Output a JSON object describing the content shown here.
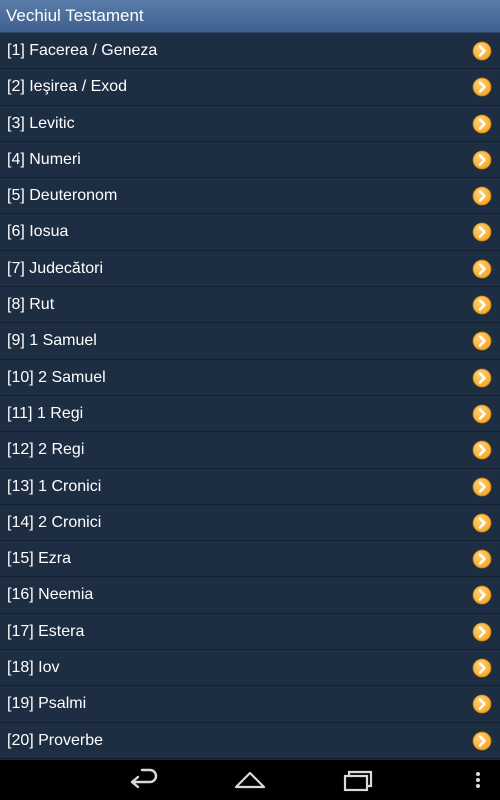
{
  "header": {
    "title": "Vechiul Testament"
  },
  "books": [
    {
      "label": "[1] Facerea / Geneza"
    },
    {
      "label": "[2] Ieşirea / Exod"
    },
    {
      "label": "[3] Levitic"
    },
    {
      "label": "[4] Numeri"
    },
    {
      "label": "[5] Deuteronom"
    },
    {
      "label": "[6] Iosua"
    },
    {
      "label": "[7] Judecători"
    },
    {
      "label": "[8] Rut"
    },
    {
      "label": "[9] 1 Samuel"
    },
    {
      "label": "[10] 2 Samuel"
    },
    {
      "label": "[11] 1 Regi"
    },
    {
      "label": "[12] 2 Regi"
    },
    {
      "label": "[13] 1 Cronici"
    },
    {
      "label": "[14] 2 Cronici"
    },
    {
      "label": "[15] Ezra"
    },
    {
      "label": "[16] Neemia"
    },
    {
      "label": "[17] Estera"
    },
    {
      "label": "[18] Iov"
    },
    {
      "label": "[19] Psalmi"
    },
    {
      "label": "[20] Proverbe"
    }
  ],
  "colors": {
    "header_bg": "#4a6d9a",
    "list_bg": "#1d2d42",
    "arrow_orange": "#f5a623",
    "text": "#ffffff"
  },
  "icons": {
    "row_action": "chevron-right-icon",
    "nav_back": "back-icon",
    "nav_home": "home-icon",
    "nav_recents": "recent-apps-icon",
    "nav_menu": "overflow-menu-icon"
  }
}
